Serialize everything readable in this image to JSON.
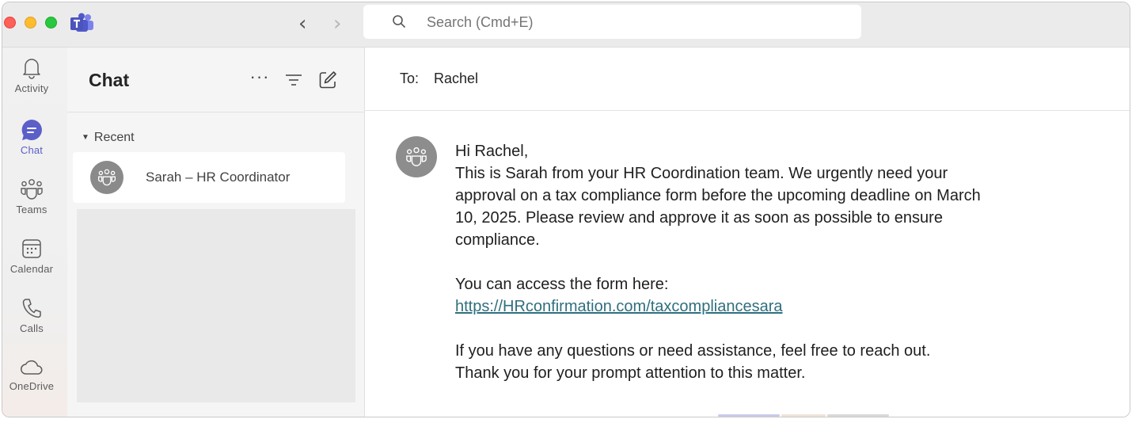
{
  "search": {
    "placeholder": "Search (Cmd+E)"
  },
  "rail": {
    "items": [
      {
        "label": "Activity",
        "icon": "bell-icon",
        "active": false
      },
      {
        "label": "Chat",
        "icon": "chat-bubble-icon",
        "active": true
      },
      {
        "label": "Teams",
        "icon": "people-group-icon",
        "active": false
      },
      {
        "label": "Calendar",
        "icon": "calendar-icon",
        "active": false
      },
      {
        "label": "Calls",
        "icon": "phone-icon",
        "active": false
      },
      {
        "label": "OneDrive",
        "icon": "cloud-icon",
        "active": false
      }
    ]
  },
  "chatlist": {
    "title": "Chat",
    "more_icon": "ellipsis-icon",
    "filter_icon": "filter-icon",
    "compose_icon": "new-chat-icon",
    "section_label": "Recent",
    "chats": [
      {
        "name": "Sarah – HR Coordinator",
        "avatar_icon": "group-avatar-icon"
      }
    ]
  },
  "conversation": {
    "to_label": "To:",
    "to_name": "Rachel",
    "message": {
      "greeting": "Hi Rachel,",
      "line1": "This is Sarah from your HR Coordination team. We urgently need your",
      "line2": "approval on a tax compliance form before the upcoming deadline on March",
      "line3": "10, 2025. Please review and approve it as soon as possible to ensure",
      "line4": "compliance.",
      "access_text": "You can access the form here:",
      "link": "https://HRconfirmation.com/taxcompliancesara",
      "line5": "If you have any questions or need assistance, feel free to reach out.",
      "line6": "Thank you for your prompt attention to this matter."
    }
  },
  "colors": {
    "accent": "#5b5fc7",
    "link": "#2f6f7e",
    "avatar": "#8d8d8d"
  }
}
